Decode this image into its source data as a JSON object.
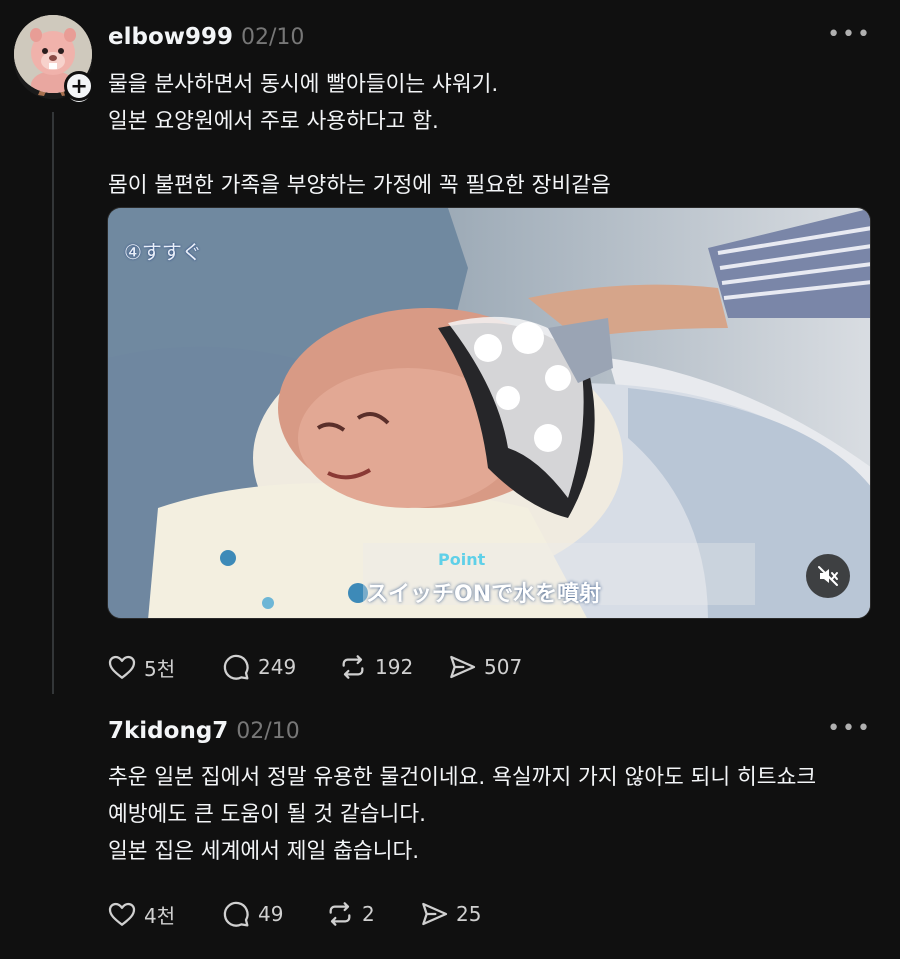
{
  "posts": [
    {
      "username": "elbow999",
      "date": "02/10",
      "text_lines": [
        "물을 분사하면서 동시에 빨아들이는 샤워기.",
        "일본 요양원에서 주로 사용하다고 함."
      ],
      "text_lines_2": [
        "몸이 불편한 가족을 부양하는 가정에 꼭 필요한 장비같음"
      ],
      "media": {
        "overlay_label": "④すすぐ",
        "caption_point": "Point",
        "caption_text": "スイッチONで水を噴射",
        "mute_icon": "speaker-muted-icon"
      },
      "stats": {
        "likes": "5천",
        "replies": "249",
        "reposts": "192",
        "shares": "507"
      }
    },
    {
      "username": "7kidong7",
      "date": "02/10",
      "text_lines": [
        "추운 일본 집에서 정말 유용한 물건이네요. 욕실까지 가지 않아도 되니 히트쇼크",
        "예방에도 큰 도움이 될 것 같습니다.",
        "일본 집은 세계에서 제일 춥습니다."
      ],
      "stats": {
        "likes": "4천",
        "replies": "49",
        "reposts": "2",
        "shares": "25"
      }
    }
  ],
  "colors": {
    "background": "#101010",
    "text": "#f3f5f7",
    "muted": "#777777",
    "divider": "#333638"
  }
}
